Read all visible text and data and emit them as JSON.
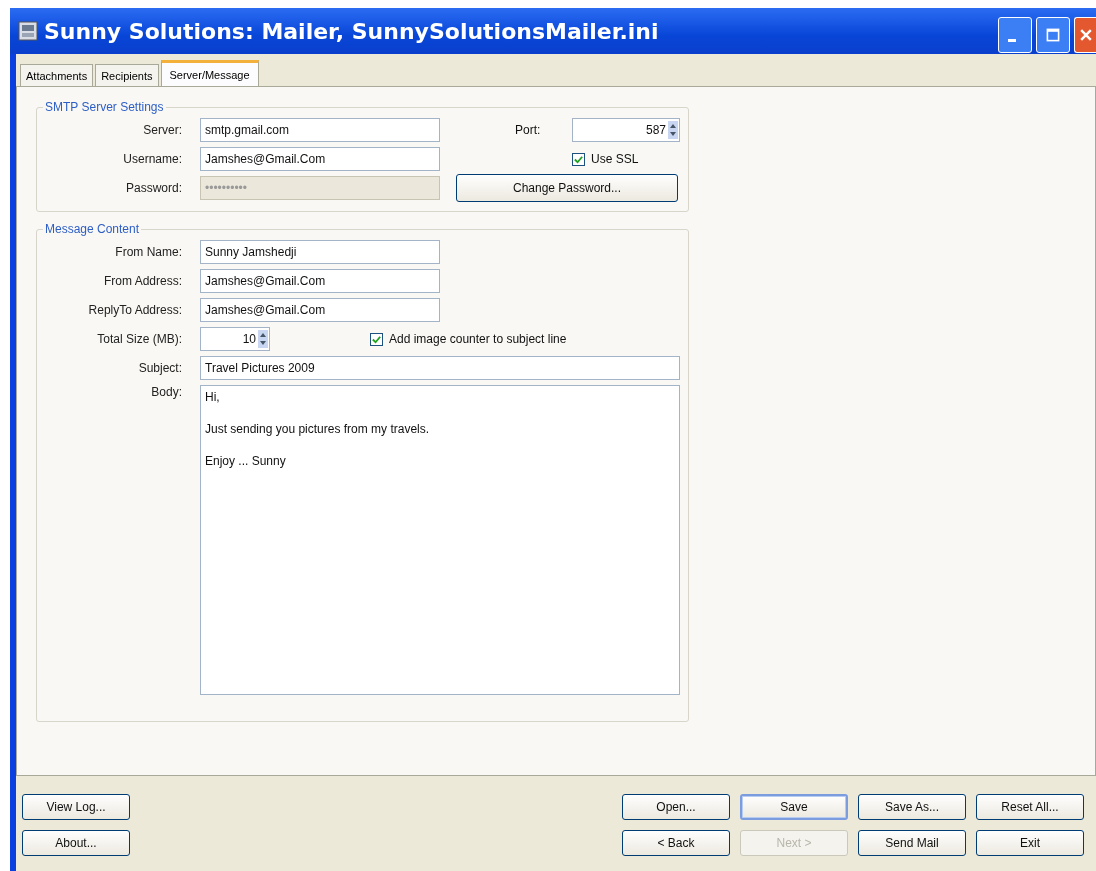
{
  "window": {
    "title": "Sunny Solutions: Mailer, SunnySolutionsMailer.ini"
  },
  "tabs": [
    {
      "label": "Attachments",
      "selected": false
    },
    {
      "label": "Recipients",
      "selected": false
    },
    {
      "label": "Server/Message",
      "selected": true
    }
  ],
  "smtp": {
    "title": "SMTP Server Settings",
    "server_label": "Server:",
    "server": "smtp.gmail.com",
    "username_label": "Username:",
    "username": "Jamshes@Gmail.Com",
    "password_label": "Password:",
    "password": "••••••••••",
    "password_disabled": true,
    "port_label": "Port:",
    "port": "587",
    "ssl_label": "Use SSL",
    "ssl_checked": true,
    "change_password": "Change Password..."
  },
  "message": {
    "title": "Message Content",
    "fields": [
      {
        "label": "From Name:",
        "value": "Sunny Jamshedji"
      },
      {
        "label": "From Address:",
        "value": "Jamshes@Gmail.Com"
      },
      {
        "label": "ReplyTo Address:",
        "value": "Jamshes@Gmail.Com"
      }
    ],
    "size_label": "Total Size (MB):",
    "size": "10",
    "counter_label": "Add image counter to subject line",
    "counter_checked": true,
    "subject_label": "Subject:",
    "subject": "Travel Pictures 2009",
    "body_label": "Body:",
    "body": [
      "Hi,",
      "Just sending you pictures from my travels.",
      "Enjoy ... Sunny"
    ]
  },
  "buttons_left": [
    {
      "label": "View Log...",
      "disabled": false,
      "default": false
    },
    {
      "label": "About...",
      "disabled": false,
      "default": false
    }
  ],
  "buttons_right": [
    {
      "label": "Open...",
      "disabled": false,
      "default": false
    },
    {
      "label": "Save",
      "disabled": false,
      "default": true
    },
    {
      "label": "Save As...",
      "disabled": false,
      "default": false
    },
    {
      "label": "Reset All...",
      "disabled": false,
      "default": false
    },
    {
      "label": "< Back",
      "disabled": false,
      "default": false
    },
    {
      "label": "Next >",
      "disabled": true,
      "default": false
    },
    {
      "label": "Send Mail",
      "disabled": false,
      "default": false
    },
    {
      "label": "Exit",
      "disabled": false,
      "default": false
    }
  ]
}
